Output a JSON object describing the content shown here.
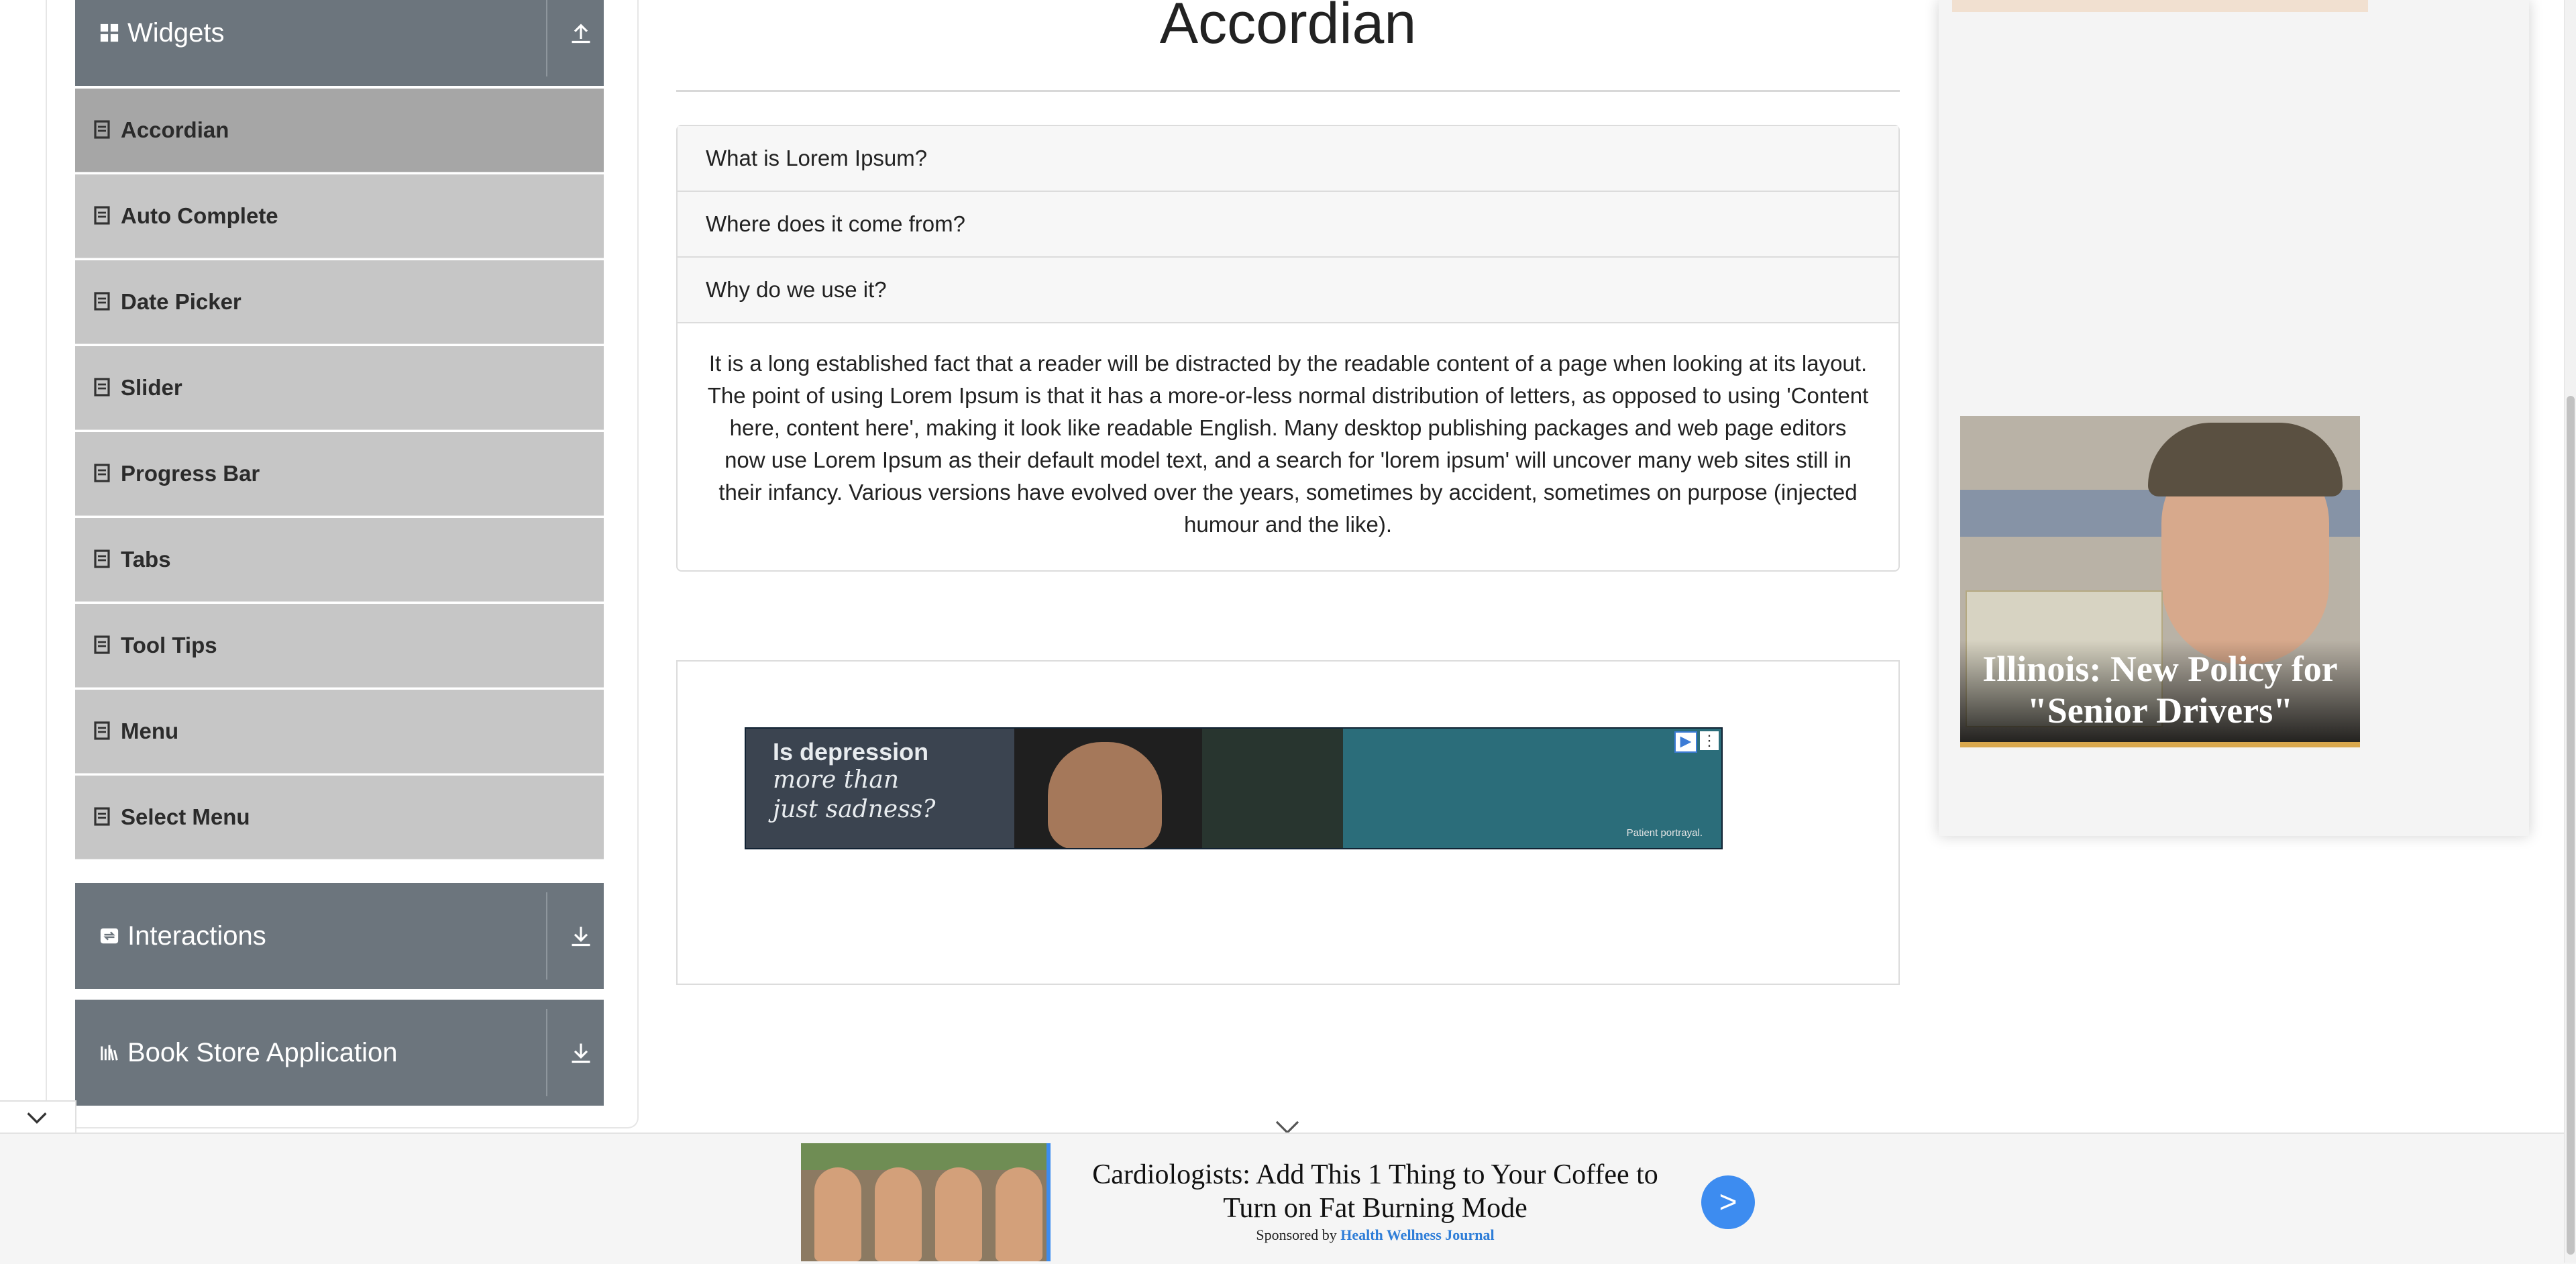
{
  "sidebar": {
    "widgets_header": "Widgets",
    "items": [
      {
        "label": "Accordian",
        "active": true
      },
      {
        "label": "Auto Complete",
        "active": false
      },
      {
        "label": "Date Picker",
        "active": false
      },
      {
        "label": "Slider",
        "active": false
      },
      {
        "label": "Progress Bar",
        "active": false
      },
      {
        "label": "Tabs",
        "active": false
      },
      {
        "label": "Tool Tips",
        "active": false
      },
      {
        "label": "Menu",
        "active": false
      },
      {
        "label": "Select Menu",
        "active": false
      }
    ],
    "interactions_header": "Interactions",
    "bookstore_header": "Book Store Application"
  },
  "main": {
    "title": "Accordian",
    "sections": [
      {
        "heading": "What is Lorem Ipsum?"
      },
      {
        "heading": "Where does it come from?"
      },
      {
        "heading": "Why do we use it?",
        "body": "It is a long established fact that a reader will be distracted by the readable content of a page when looking at its layout. The point of using Lorem Ipsum is that it has a more-or-less normal distribution of letters, as opposed to using 'Content here, content here', making it look like readable English. Many desktop publishing packages and web page editors now use Lorem Ipsum as their default model text, and a search for 'lorem ipsum' will uncover many web sites still in their infancy. Various versions have evolved over the years, sometimes by accident, sometimes on purpose (injected humour and the like)."
      }
    ]
  },
  "ads": {
    "banner": {
      "line1": "Is depression",
      "line2": "more than",
      "line3": "just sadness?",
      "note": "Patient portrayal."
    },
    "side": {
      "caption_line1": "Illinois: New Policy for",
      "caption_line2": "\"Senior Drivers\""
    },
    "bottom": {
      "title": "Cardiologists: Add This 1 Thing to Your Coffee to Turn on Fat Burning Mode",
      "sponsor_prefix": "Sponsored by",
      "sponsor": "Health Wellness Journal",
      "cta": ">"
    }
  },
  "colors": {
    "group_header": "#6c757d",
    "menu_item": "#c6c6c6",
    "menu_item_active": "#a6a6a6",
    "accent_blue": "#3d8cf0"
  },
  "icons": {
    "widgets": "grid-icon",
    "collapse": "upload-arrow-icon",
    "expand": "download-arrow-icon",
    "menu_item": "document-icon",
    "interactions": "interactions-icon",
    "bookstore": "books-icon"
  }
}
